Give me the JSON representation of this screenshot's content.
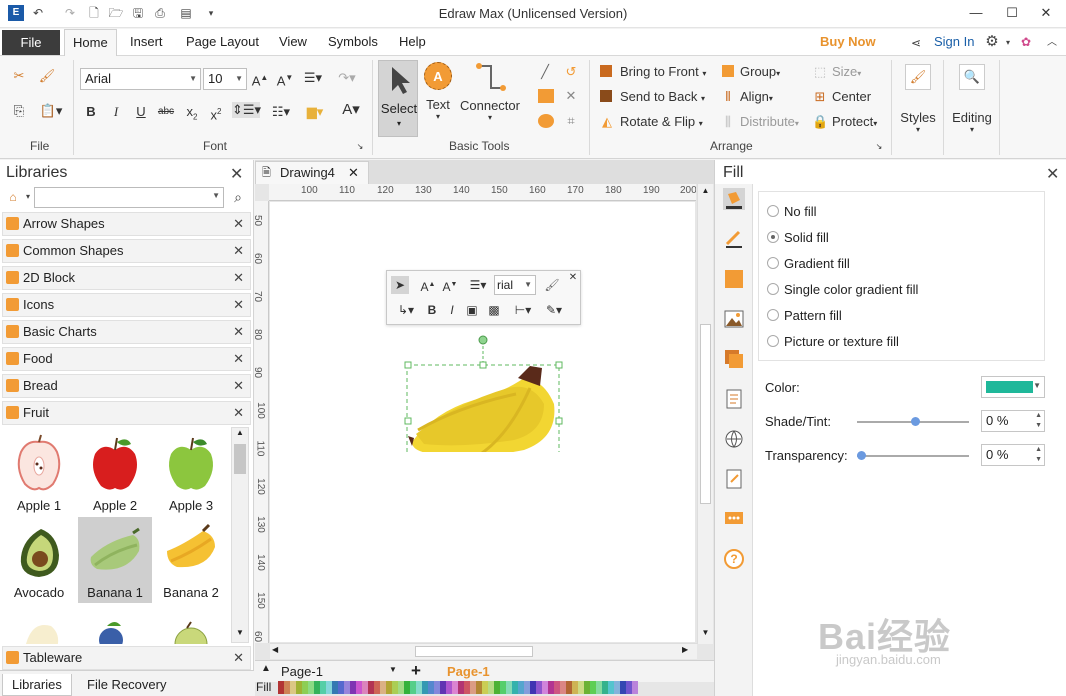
{
  "window": {
    "title": "Edraw Max (Unlicensed Version)"
  },
  "menu": {
    "file": "File",
    "tabs": [
      "Home",
      "Insert",
      "Page Layout",
      "View",
      "Symbols",
      "Help"
    ],
    "buy_now": "Buy Now",
    "sign_in": "Sign In"
  },
  "ribbon": {
    "file_group": "File",
    "font": {
      "family": "Arial",
      "size": "10",
      "group_label": "Font"
    },
    "basic_tools": {
      "select": "Select",
      "text": "Text",
      "connector": "Connector",
      "group_label": "Basic Tools"
    },
    "arrange": {
      "bring_to_front": "Bring to Front",
      "send_to_back": "Send to Back",
      "rotate_flip": "Rotate & Flip",
      "group": "Group",
      "align": "Align",
      "distribute": "Distribute",
      "size": "Size",
      "center": "Center",
      "protect": "Protect",
      "group_label": "Arrange"
    },
    "styles": "Styles",
    "editing": "Editing"
  },
  "libraries": {
    "title": "Libraries",
    "items": [
      "Arrow Shapes",
      "Common Shapes",
      "2D Block",
      "Icons",
      "Basic Charts",
      "Food",
      "Bread",
      "Fruit"
    ],
    "thumbs": [
      "Apple 1",
      "Apple 2",
      "Apple 3",
      "Avocado",
      "Banana 1",
      "Banana 2"
    ],
    "tableware": "Tableware",
    "bottom_tabs": [
      "Libraries",
      "File Recovery"
    ]
  },
  "canvas": {
    "doc_tab": "Drawing4",
    "hruler": [
      "100",
      "110",
      "120",
      "130",
      "140",
      "150",
      "160",
      "170",
      "180",
      "190",
      "200"
    ],
    "vruler": [
      "50",
      "60",
      "70",
      "80",
      "90",
      "100",
      "110",
      "120",
      "130",
      "140",
      "150",
      "60"
    ],
    "float_font": "rial",
    "page_select": "Page-1",
    "page_tab": "Page-1",
    "fill_label": "Fill"
  },
  "fill_panel": {
    "title": "Fill",
    "options": [
      "No fill",
      "Solid fill",
      "Gradient fill",
      "Single color gradient fill",
      "Pattern fill",
      "Picture or texture fill"
    ],
    "selected_index": 1,
    "color_label": "Color:",
    "color": "#1fb89a",
    "shade_label": "Shade/Tint:",
    "shade_value": "0 %",
    "shade_level": 0.5,
    "transparency_label": "Transparency:",
    "transparency_value": "0 %",
    "transparency_level": 0.0
  },
  "watermark": {
    "main": "Bai经验",
    "url": "jingyan.baidu.com"
  },
  "colors": {
    "accent": "#f29b35",
    "file_tab": "#3c3c3c",
    "buy_now": "#e8932e",
    "sign_in": "#1a5fa8",
    "banana": "#f2d632"
  }
}
